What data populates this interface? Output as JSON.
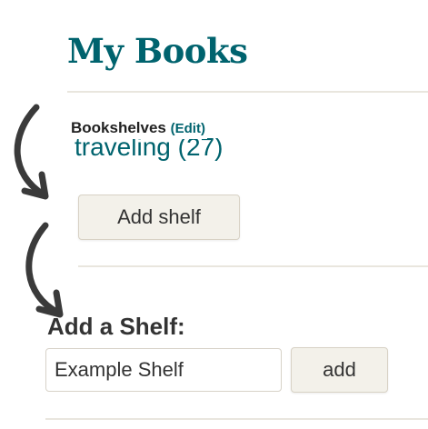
{
  "page": {
    "title": "My Books"
  },
  "bookshelves": {
    "header_label": "Bookshelves",
    "edit_label": "(Edit)",
    "visible_shelf": "traveling (27)",
    "add_shelf_button": "Add shelf"
  },
  "add_shelf_form": {
    "heading": "Add a Shelf:",
    "input_value": "Example Shelf",
    "submit_label": "add"
  },
  "annotations": {
    "arrow_color": "#3a3a3a",
    "arrow_icon": "curved-arrow-icon"
  },
  "colors": {
    "brand_teal": "#00636e",
    "button_bg": "#f3f1ea"
  }
}
